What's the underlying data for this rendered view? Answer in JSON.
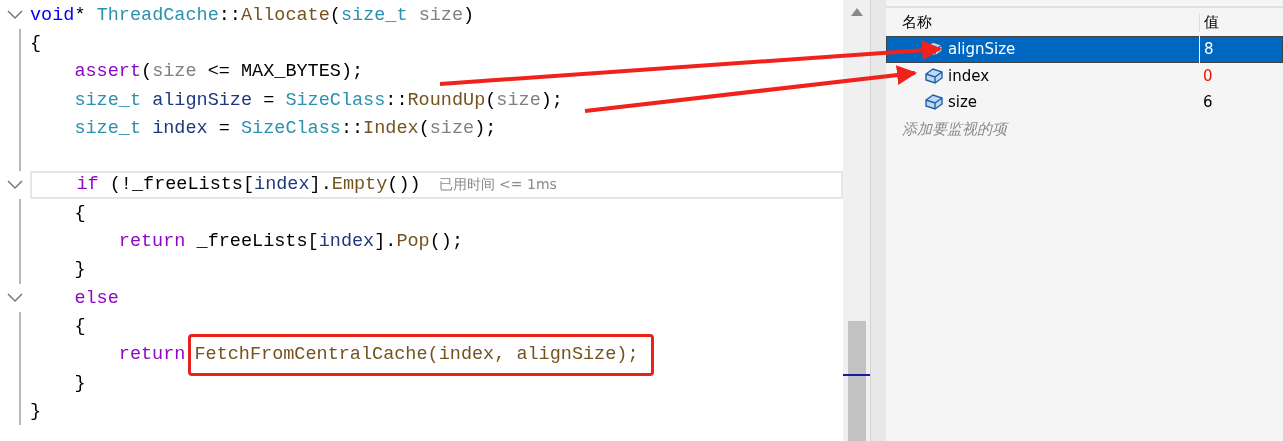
{
  "editor": {
    "lines": [
      {
        "foldable": true,
        "current": false,
        "tokens": [
          {
            "kind": "keyword",
            "text": "void"
          },
          {
            "kind": "plain",
            "text": "* "
          },
          {
            "kind": "type",
            "text": "ThreadCache"
          },
          {
            "kind": "plain",
            "text": "::"
          },
          {
            "kind": "function",
            "text": "Allocate"
          },
          {
            "kind": "plain",
            "text": "("
          },
          {
            "kind": "type",
            "text": "size_t"
          },
          {
            "kind": "param",
            "text": " size"
          },
          {
            "kind": "plain",
            "text": ")"
          }
        ]
      },
      {
        "foldable": false,
        "current": false,
        "tokens": [
          {
            "kind": "plain",
            "text": "{"
          }
        ],
        "children": [
          {
            "foldable": false,
            "current": false,
            "tokens": [
              {
                "kind": "macro",
                "text": "assert"
              },
              {
                "kind": "plain",
                "text": "("
              },
              {
                "kind": "param",
                "text": "size"
              },
              {
                "kind": "plain",
                "text": " <= MAX_BYTES);"
              }
            ]
          },
          {
            "foldable": false,
            "current": false,
            "tokens": [
              {
                "kind": "type",
                "text": "size_t"
              },
              {
                "kind": "local",
                "text": " alignSize"
              },
              {
                "kind": "plain",
                "text": " = "
              },
              {
                "kind": "type",
                "text": "SizeClass"
              },
              {
                "kind": "plain",
                "text": "::"
              },
              {
                "kind": "function",
                "text": "RoundUp"
              },
              {
                "kind": "plain",
                "text": "("
              },
              {
                "kind": "param",
                "text": "size"
              },
              {
                "kind": "plain",
                "text": ");"
              }
            ]
          },
          {
            "foldable": false,
            "current": false,
            "tokens": [
              {
                "kind": "type",
                "text": "size_t"
              },
              {
                "kind": "local",
                "text": " index"
              },
              {
                "kind": "plain",
                "text": " = "
              },
              {
                "kind": "type",
                "text": "SizeClass"
              },
              {
                "kind": "plain",
                "text": "::"
              },
              {
                "kind": "function",
                "text": "Index"
              },
              {
                "kind": "plain",
                "text": "("
              },
              {
                "kind": "param",
                "text": "size"
              },
              {
                "kind": "plain",
                "text": ");"
              }
            ]
          },
          {
            "foldable": false,
            "current": false
          },
          {
            "foldable": true,
            "current": true,
            "tokens": [
              {
                "kind": "control",
                "text": "if"
              },
              {
                "kind": "plain",
                "text": " (!_freeLists["
              },
              {
                "kind": "local",
                "text": "index"
              },
              {
                "kind": "plain",
                "text": "]."
              },
              {
                "kind": "function",
                "text": "Empty"
              },
              {
                "kind": "plain",
                "text": "())"
              },
              {
                "kind": "hint",
                "text": "已用时间 <= 1ms"
              }
            ]
          },
          {
            "foldable": false,
            "current": false,
            "tokens": [
              {
                "kind": "plain",
                "text": "{"
              }
            ],
            "children": [
              {
                "foldable": false,
                "current": false,
                "tokens": [
                  {
                    "kind": "control",
                    "text": "return"
                  },
                  {
                    "kind": "plain",
                    "text": " _freeLists["
                  },
                  {
                    "kind": "local",
                    "text": "index"
                  },
                  {
                    "kind": "plain",
                    "text": "]."
                  },
                  {
                    "kind": "function",
                    "text": "Pop"
                  },
                  {
                    "kind": "plain",
                    "text": "();"
                  }
                ]
              }
            ]
          },
          {
            "foldable": false,
            "current": false,
            "tokens": [
              {
                "kind": "plain",
                "text": "}"
              }
            ]
          },
          {
            "foldable": true,
            "current": false,
            "tokens": [
              {
                "kind": "control",
                "text": "else"
              }
            ]
          },
          {
            "foldable": false,
            "current": false,
            "tokens": [
              {
                "kind": "plain",
                "text": "{"
              }
            ],
            "children": [
              {
                "foldable": false,
                "current": false,
                "tokens": [
                  {
                    "kind": "control",
                    "text": "return"
                  },
                  {
                    "kind": "boxed",
                    "text": "FetchFromCentralCache(index, alignSize);"
                  }
                ]
              }
            ]
          },
          {
            "foldable": false,
            "current": false,
            "tokens": [
              {
                "kind": "plain",
                "text": "}"
              }
            ]
          }
        ]
      },
      {
        "foldable": false,
        "current": false,
        "tokens": [
          {
            "kind": "plain",
            "text": "}"
          }
        ]
      }
    ]
  },
  "watch": {
    "columns": [
      "名称",
      "值"
    ],
    "rows": [
      {
        "name": "alignSize",
        "value": "8",
        "selected": true,
        "changed": false
      },
      {
        "name": "index",
        "value": "0",
        "selected": false,
        "changed": true
      },
      {
        "name": "size",
        "value": "6",
        "selected": false,
        "changed": false
      }
    ],
    "placeholder": "添加要监视的项"
  }
}
